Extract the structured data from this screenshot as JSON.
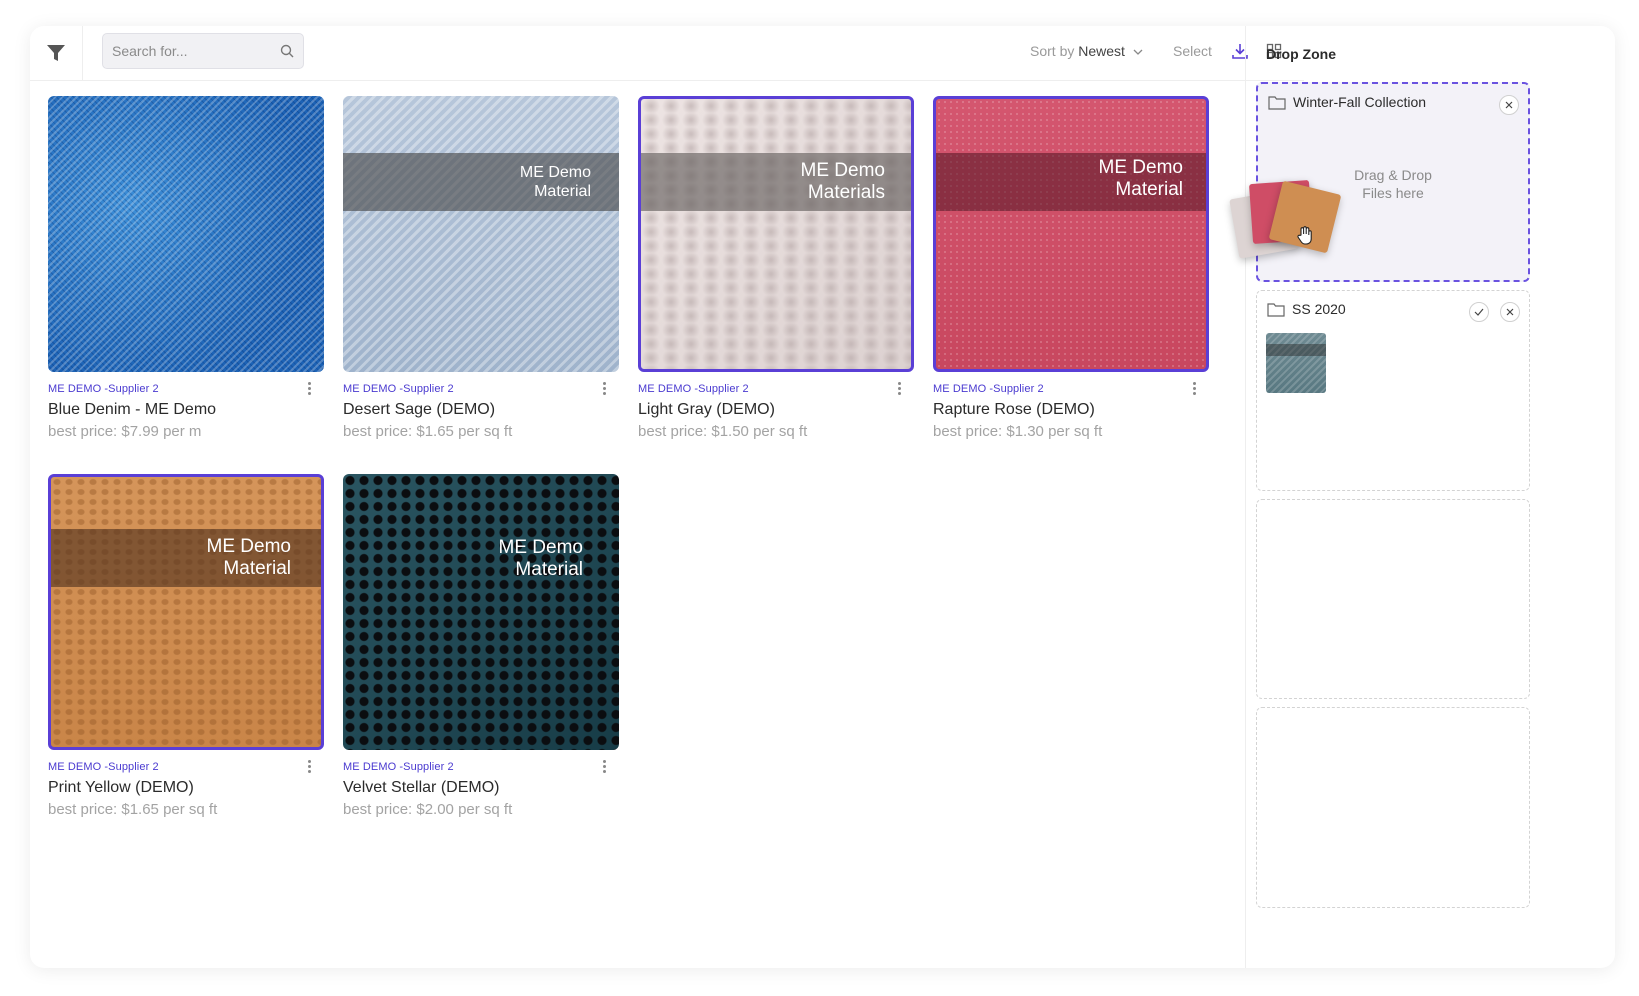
{
  "toolbar": {
    "search_placeholder": "Search for...",
    "sort_prefix": "Sort by",
    "sort_value": "Newest",
    "select_label": "Select"
  },
  "products": [
    {
      "supplier": "ME DEMO -Supplier 2",
      "name": "Blue Denim - ME Demo",
      "price": "best price: $7.99 per m",
      "overlay": [],
      "selected": false
    },
    {
      "supplier": "ME DEMO -Supplier 2",
      "name": "Desert Sage (DEMO)",
      "price": "best price: $1.65 per sq ft",
      "overlay": [
        "ME Demo",
        "Material"
      ],
      "selected": false
    },
    {
      "supplier": "ME DEMO -Supplier 2",
      "name": "Light Gray (DEMO)",
      "price": "best price: $1.50 per sq ft",
      "overlay": [
        "ME Demo",
        "Materials"
      ],
      "selected": true
    },
    {
      "supplier": "ME DEMO -Supplier 2",
      "name": "Rapture Rose (DEMO)",
      "price": "best price: $1.30 per sq ft",
      "overlay": [
        "ME Demo",
        "Material"
      ],
      "selected": true
    },
    {
      "supplier": "ME DEMO -Supplier 2",
      "name": "Print Yellow (DEMO)",
      "price": "best price: $1.65 per sq ft",
      "overlay": [
        "ME Demo",
        "Material"
      ],
      "selected": true
    },
    {
      "supplier": "ME DEMO -Supplier 2",
      "name": "Velvet Stellar (DEMO)",
      "price": "best price: $2.00 per sq ft",
      "overlay": [
        "ME Demo",
        "Material"
      ],
      "selected": false
    }
  ],
  "drop_zone": {
    "title": "Drop Zone",
    "collections": [
      {
        "name": "Winter-Fall Collection",
        "hint": [
          "Drag & Drop",
          "Files here"
        ]
      },
      {
        "name": "SS 2020"
      }
    ]
  },
  "colors": {
    "accent": "#5a3fd6",
    "supplier_text": "#4a3ad0"
  }
}
